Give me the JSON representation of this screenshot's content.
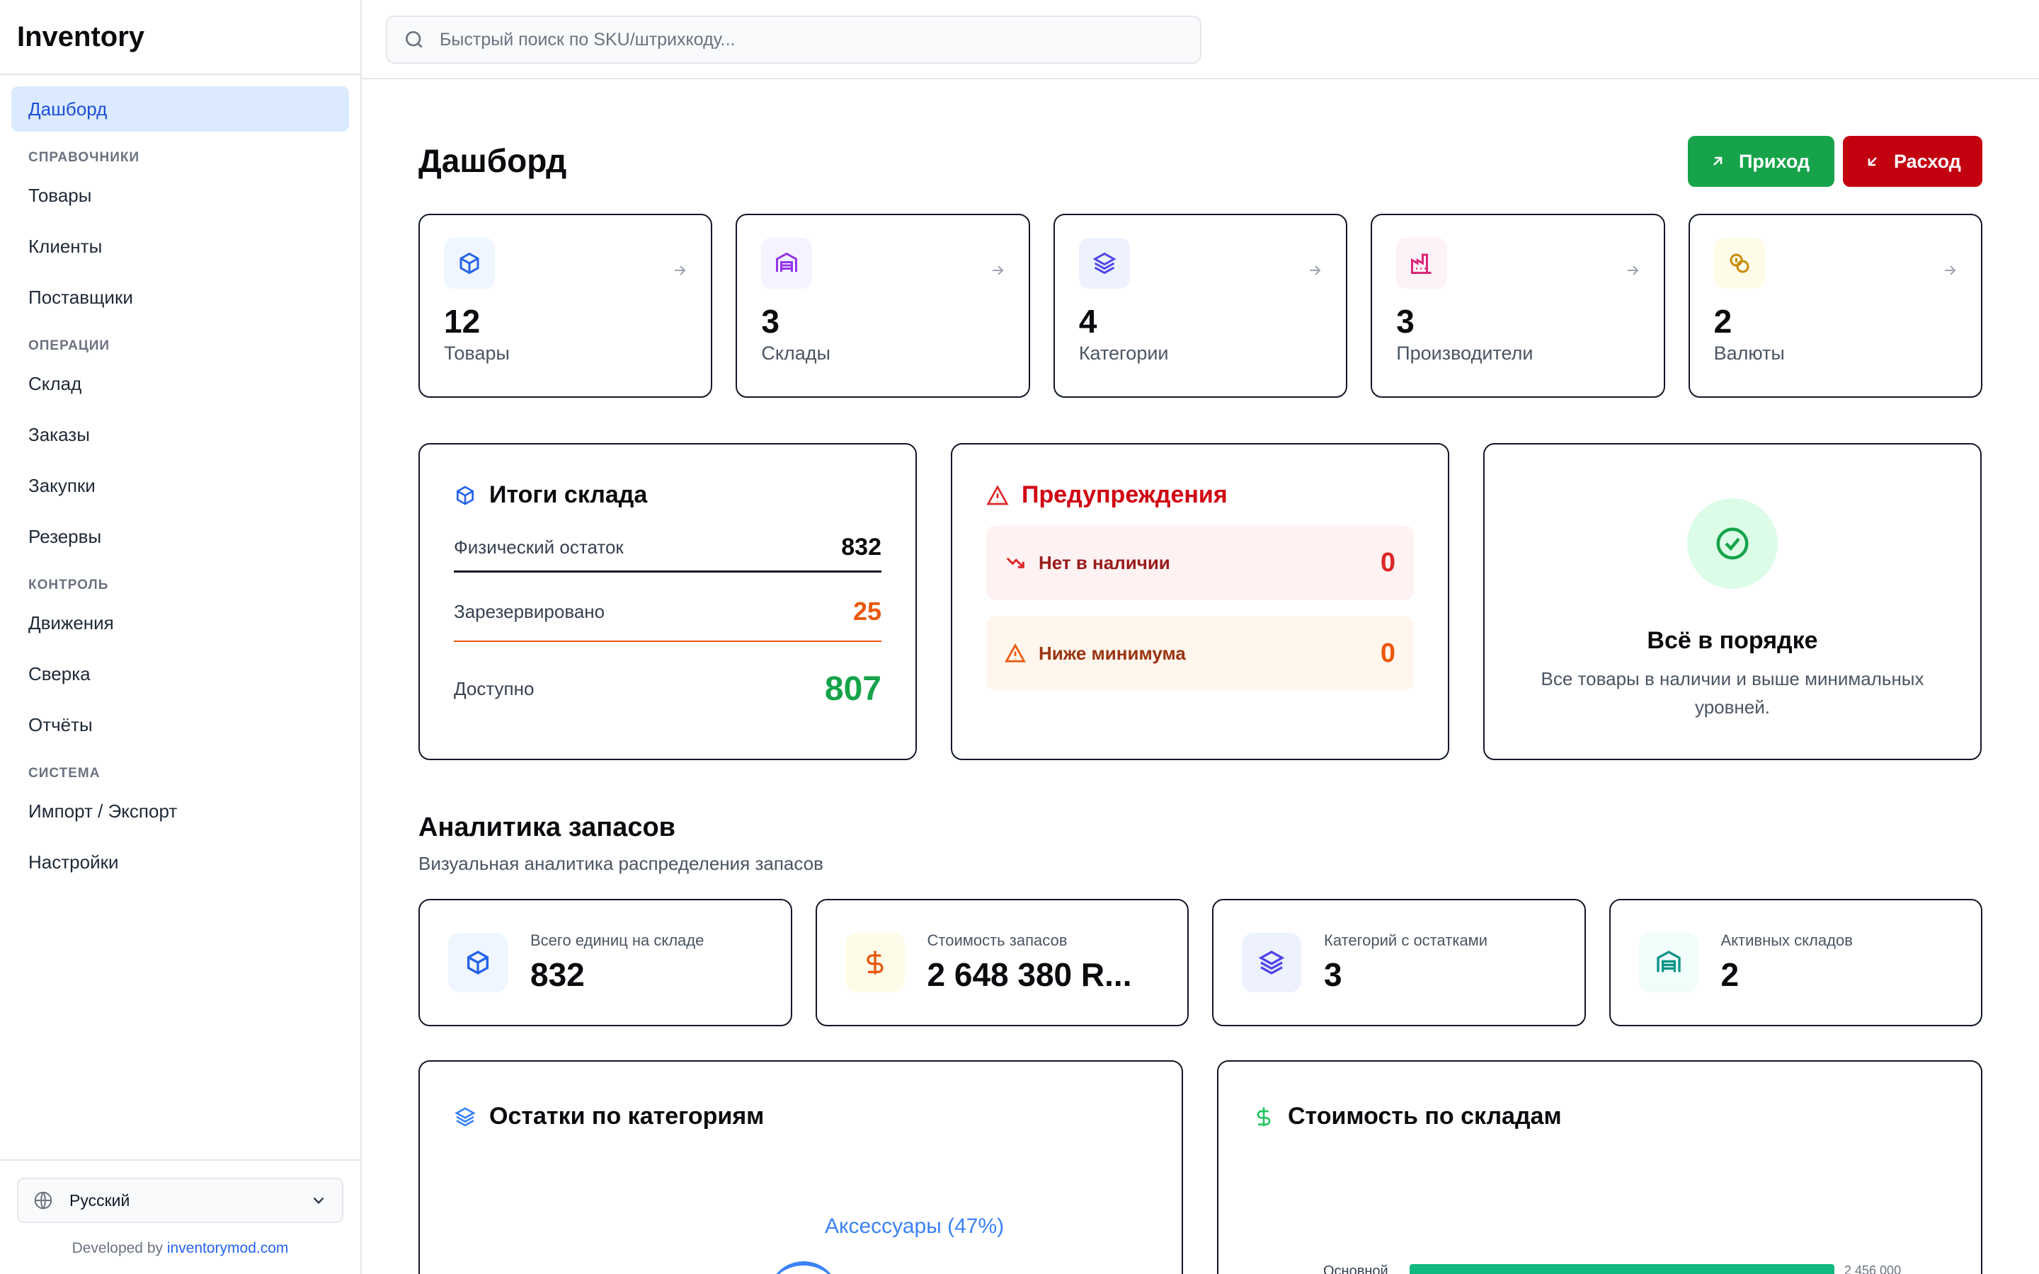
{
  "app": {
    "title": "Inventory"
  },
  "sidebar": {
    "active": {
      "label": "Дашборд"
    },
    "sections": [
      {
        "title": "СПРАВОЧНИКИ",
        "items": [
          "Товары",
          "Клиенты",
          "Поставщики"
        ]
      },
      {
        "title": "ОПЕРАЦИИ",
        "items": [
          "Склад",
          "Заказы",
          "Закупки",
          "Резервы"
        ]
      },
      {
        "title": "КОНТРОЛЬ",
        "items": [
          "Движения",
          "Сверка",
          "Отчёты"
        ]
      },
      {
        "title": "СИСТЕМА",
        "items": [
          "Импорт / Экспорт",
          "Настройки"
        ]
      }
    ],
    "language": "Русский",
    "developed_by": "Developed by",
    "developer_link": "inventorymod.com"
  },
  "search": {
    "placeholder": "Быстрый поиск по SKU/штрихкоду..."
  },
  "page": {
    "title": "Дашборд",
    "btn_in": "Приход",
    "btn_out": "Расход"
  },
  "stats": [
    {
      "value": "12",
      "label": "Товары",
      "icon": "box-icon",
      "bg": "#eff6ff",
      "color": "#2563eb"
    },
    {
      "value": "3",
      "label": "Склады",
      "icon": "warehouse-icon",
      "bg": "#f5f3ff",
      "color": "#9333ea"
    },
    {
      "value": "4",
      "label": "Категории",
      "icon": "layers-icon",
      "bg": "#eef2ff",
      "color": "#4f46e5"
    },
    {
      "value": "3",
      "label": "Производители",
      "icon": "factory-icon",
      "bg": "#fdf2f8",
      "color": "#db2777"
    },
    {
      "value": "2",
      "label": "Валюты",
      "icon": "coins-icon",
      "bg": "#fefce8",
      "color": "#ca8a04"
    }
  ],
  "stock_summary": {
    "title": "Итоги склада",
    "physical_label": "Физический остаток",
    "physical_value": "832",
    "reserved_label": "Зарезервировано",
    "reserved_value": "25",
    "available_label": "Доступно",
    "available_value": "807"
  },
  "warnings": {
    "title": "Предупреждения",
    "out_of_stock_label": "Нет в наличии",
    "out_of_stock_value": "0",
    "below_min_label": "Ниже минимума",
    "below_min_value": "0"
  },
  "status": {
    "title": "Всё в порядке",
    "text": "Все товары в наличии и выше минимальных уровней."
  },
  "analytics": {
    "title": "Аналитика запасов",
    "subtitle": "Визуальная аналитика распределения запасов",
    "metrics": [
      {
        "label": "Всего единиц на складе",
        "value": "832",
        "icon": "box-icon",
        "bg": "#eff6ff",
        "color": "#2563eb"
      },
      {
        "label": "Стоимость запасов",
        "value": "2 648 380 R...",
        "icon": "dollar-icon",
        "bg": "#fefce8",
        "color": "#ea580c"
      },
      {
        "label": "Категорий с остатками",
        "value": "3",
        "icon": "layers-icon",
        "bg": "#eef2ff",
        "color": "#4f46e5"
      },
      {
        "label": "Активных складов",
        "value": "2",
        "icon": "warehouse-icon",
        "bg": "#f0fdfa",
        "color": "#0d9488"
      }
    ],
    "chart_categories_title": "Остатки по категориям",
    "chart_categories_label": "Аксессуары (47%)",
    "chart_warehouses_title": "Стоимость по складам",
    "chart_warehouses_bar_label": "Основной",
    "chart_warehouses_bar_value": "2 456 000"
  },
  "colors": {
    "accent_blue": "#1d4ed8",
    "success": "#16a34a",
    "danger": "#c30010",
    "warning": "#ea580c"
  }
}
